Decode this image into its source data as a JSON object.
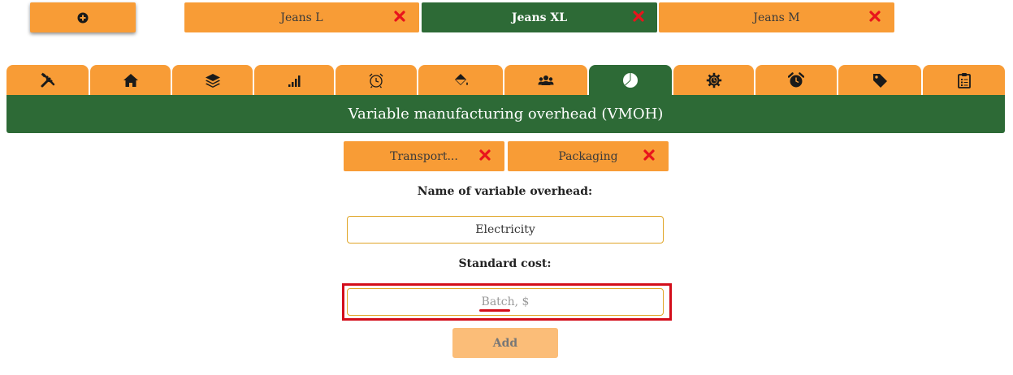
{
  "header": {
    "add_icon": "plus-circle-icon",
    "products": [
      {
        "label": "Jeans L",
        "active": false
      },
      {
        "label": "Jeans XL",
        "active": true
      },
      {
        "label": "Jeans M",
        "active": false
      }
    ]
  },
  "icon_tabs": [
    {
      "icon": "tools-icon",
      "active": false
    },
    {
      "icon": "home-icon",
      "active": false
    },
    {
      "icon": "layers-icon",
      "active": false
    },
    {
      "icon": "signal-bars-icon",
      "active": false
    },
    {
      "icon": "alarm-clock-outline-icon",
      "active": false
    },
    {
      "icon": "paint-bucket-icon",
      "active": false
    },
    {
      "icon": "users-icon",
      "active": false
    },
    {
      "icon": "pie-chart-icon",
      "active": true
    },
    {
      "icon": "gear-icon",
      "active": false
    },
    {
      "icon": "alarm-clock-icon",
      "active": false
    },
    {
      "icon": "price-tag-icon",
      "active": false
    },
    {
      "icon": "clipboard-list-icon",
      "active": false
    }
  ],
  "section": {
    "title": "Variable manufacturing overhead (VMOH)"
  },
  "overheads": [
    {
      "label": "Transport..."
    },
    {
      "label": "Packaging"
    }
  ],
  "form": {
    "name_label": "Name of variable overhead:",
    "name_value": "Electricity",
    "cost_label": "Standard cost:",
    "cost_placeholder_a": "Batch",
    "cost_placeholder_b": ", $",
    "add_label": "Add"
  },
  "colors": {
    "orange": "#f89c36",
    "green": "#2d6a36",
    "remove_red": "#e8141c",
    "highlight_red": "#d30d1a"
  }
}
